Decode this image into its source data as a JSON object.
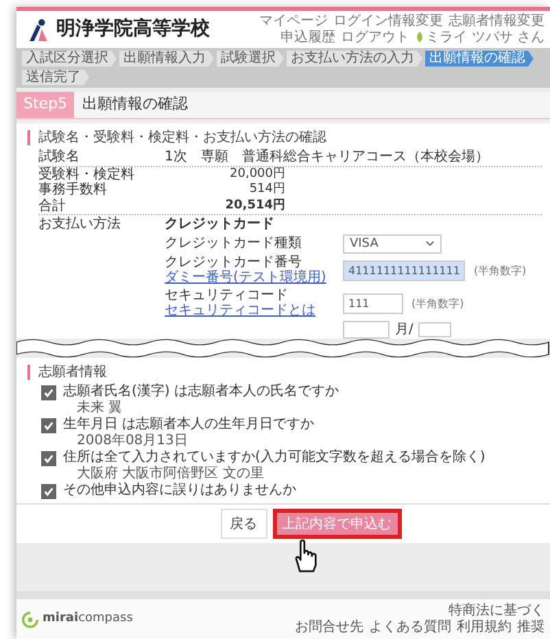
{
  "header": {
    "title": "明浄学院高等学校",
    "nav": [
      "マイページ",
      "ログイン情報変更",
      "志願者情報変更",
      "申込履歴",
      "ログアウト"
    ],
    "user": "ミライ ツバサ さん"
  },
  "steps": [
    {
      "label": "入試区分選択",
      "selected": false
    },
    {
      "label": "出願情報入力",
      "selected": false
    },
    {
      "label": "試験選択",
      "selected": false
    },
    {
      "label": "お支払い方法の入力",
      "selected": false
    },
    {
      "label": "出願情報の確認",
      "selected": true
    },
    {
      "label": "送信完了",
      "selected": false
    }
  ],
  "page_heading": {
    "step": "Step5",
    "title": "出願情報の確認"
  },
  "exam_section": {
    "title": "試験名・受験料・検定料・お支払い方法の確認",
    "rows": [
      {
        "label": "試験名",
        "value": "1次　専願　普通科総合キャリアコース（本校会場）",
        "kind": "text"
      },
      {
        "label": "受験料・検定料",
        "value": "20,000円",
        "kind": "amount"
      },
      {
        "label": "事務手数料",
        "value": "514円",
        "kind": "amount"
      },
      {
        "label": "合計",
        "value": "20,514円",
        "kind": "total"
      }
    ],
    "payment": {
      "label": "お支払い方法",
      "method": "クレジットカード",
      "fields": [
        {
          "label": "クレジットカード種類",
          "kind": "select",
          "value": "VISA",
          "autofilled": false
        },
        {
          "label": "クレジットカード番号",
          "kind": "input",
          "value": "4111111111111111",
          "note": "(半角数字)",
          "link": "ダミー番号(テスト環境用)",
          "autofilled": true
        },
        {
          "label": "セキュリティコード",
          "kind": "input",
          "value": "111",
          "note": "(半角数字)",
          "link": "セキュリティコードとは",
          "autofilled": false
        }
      ],
      "expiry_fragment": "月/"
    }
  },
  "applicant_section": {
    "title": "志願者情報",
    "checks": [
      {
        "question": "志願者氏名(漢字) は志願者本人の氏名ですか",
        "answer": "未来 翼",
        "checked": true
      },
      {
        "question": "生年月日 は志願者本人の生年月日ですか",
        "answer": "2008年08月13日",
        "checked": true
      },
      {
        "question": "住所は全て入力されていますか(入力可能文字数を超える場合を除く)",
        "answer": "大阪府 大阪市阿倍野区 文の里",
        "checked": true
      },
      {
        "question": "その他申込内容に誤りはありませんか",
        "checked": true
      }
    ]
  },
  "buttons": [
    {
      "label": "戻る",
      "kind": "secondary",
      "highlighted": false
    },
    {
      "label": "上記内容で申込む",
      "kind": "primary",
      "highlighted": true
    }
  ],
  "footer": {
    "brand": "**mirai**compass",
    "note": "特商法に基づく",
    "links": [
      "お問合せ先",
      "よくある質問",
      "利用規約",
      "推奨"
    ]
  }
}
